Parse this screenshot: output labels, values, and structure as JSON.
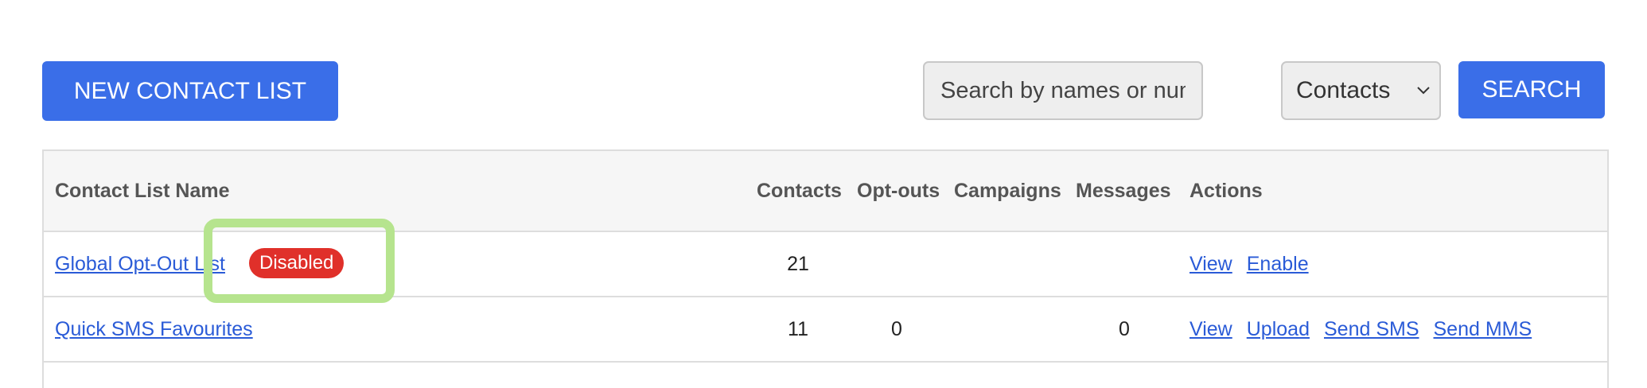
{
  "toolbar": {
    "new_button_label": "NEW CONTACT LIST",
    "search_placeholder": "Search by names or numbers...",
    "filter_selected": "Contacts",
    "search_button_label": "SEARCH"
  },
  "table": {
    "headers": {
      "name": "Contact List Name",
      "contacts": "Contacts",
      "optouts": "Opt-outs",
      "campaigns": "Campaigns",
      "messages": "Messages",
      "actions": "Actions"
    },
    "rows": [
      {
        "name": "Global Opt-Out List",
        "badge": "Disabled",
        "contacts": "21",
        "optouts": "",
        "campaigns": "",
        "messages": "",
        "actions": [
          "View",
          "Enable"
        ]
      },
      {
        "name": "Quick SMS Favourites",
        "badge": "",
        "contacts": "11",
        "optouts": "0",
        "campaigns": "",
        "messages": "0",
        "actions": [
          "View",
          "Upload",
          "Send SMS",
          "Send MMS"
        ]
      }
    ]
  },
  "colors": {
    "primary_button": "#3a6ee8",
    "link": "#2a5bd7",
    "badge_disabled": "#e0302a",
    "highlight": "#b6e48e"
  },
  "icons": {
    "select_chevron": "chevron-down-icon"
  }
}
